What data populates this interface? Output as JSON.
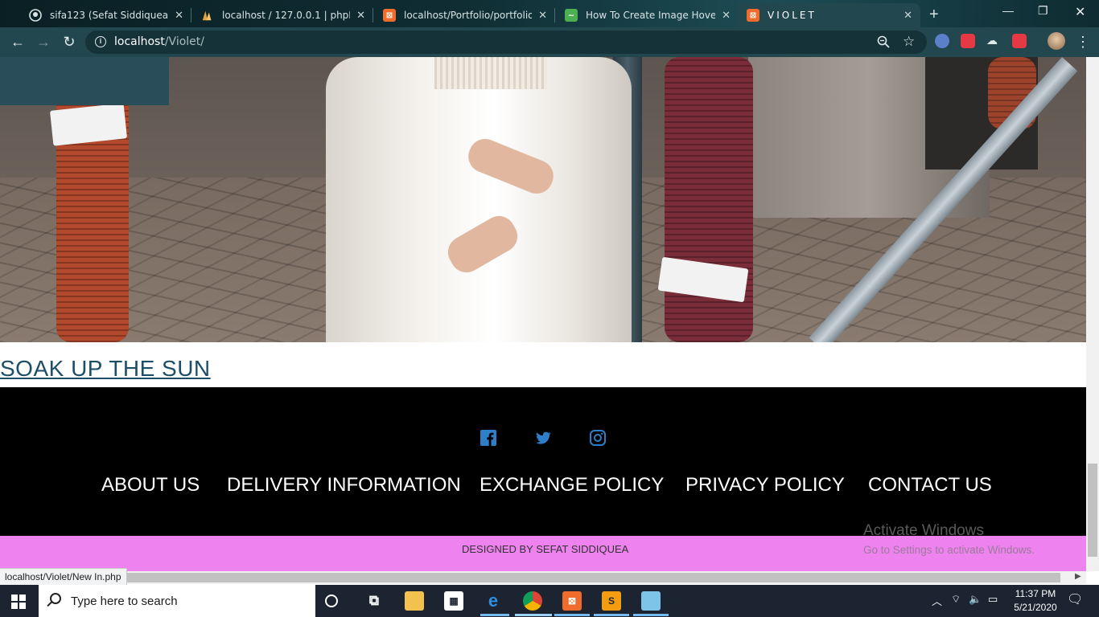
{
  "browser": {
    "tabs": [
      {
        "title": "sifa123 (Sefat Siddiquea Sifa)",
        "icon": "github-icon",
        "active": false
      },
      {
        "title": "localhost / 127.0.0.1 | phpMyA",
        "icon": "phpmyadmin-icon",
        "active": false
      },
      {
        "title": "localhost/Portfolio/portfolio.ph",
        "icon": "xampp-icon",
        "active": false
      },
      {
        "title": "How To Create Image Hover O",
        "icon": "w3schools-icon",
        "active": false
      },
      {
        "title": "VIOLET",
        "icon": "xampp-icon",
        "active": true
      }
    ],
    "close_glyph": "✕",
    "new_tab_glyph": "+",
    "address": {
      "host": "localhost",
      "path": "/Violet/"
    },
    "status_url": "localhost/Violet/New In.php"
  },
  "page": {
    "caption": "SOAK UP THE SUN",
    "footer": {
      "social": [
        "facebook-icon",
        "twitter-icon",
        "instagram-icon"
      ],
      "social_color": "#2f7ec9",
      "links": [
        "ABOUT US",
        "DELIVERY INFORMATION",
        "EXCHANGE POLICY",
        "PRIVACY POLICY",
        "CONTACT US"
      ],
      "credit": "DESIGNED BY SEFAT SIDDIQUEA",
      "credit_bg": "#ee82ee"
    },
    "watermark": {
      "title": "Activate Windows",
      "subtitle": "Go to Settings to activate Windows."
    }
  },
  "taskbar": {
    "search_placeholder": "Type here to search",
    "time": "11:37 PM",
    "date": "5/21/2020"
  }
}
